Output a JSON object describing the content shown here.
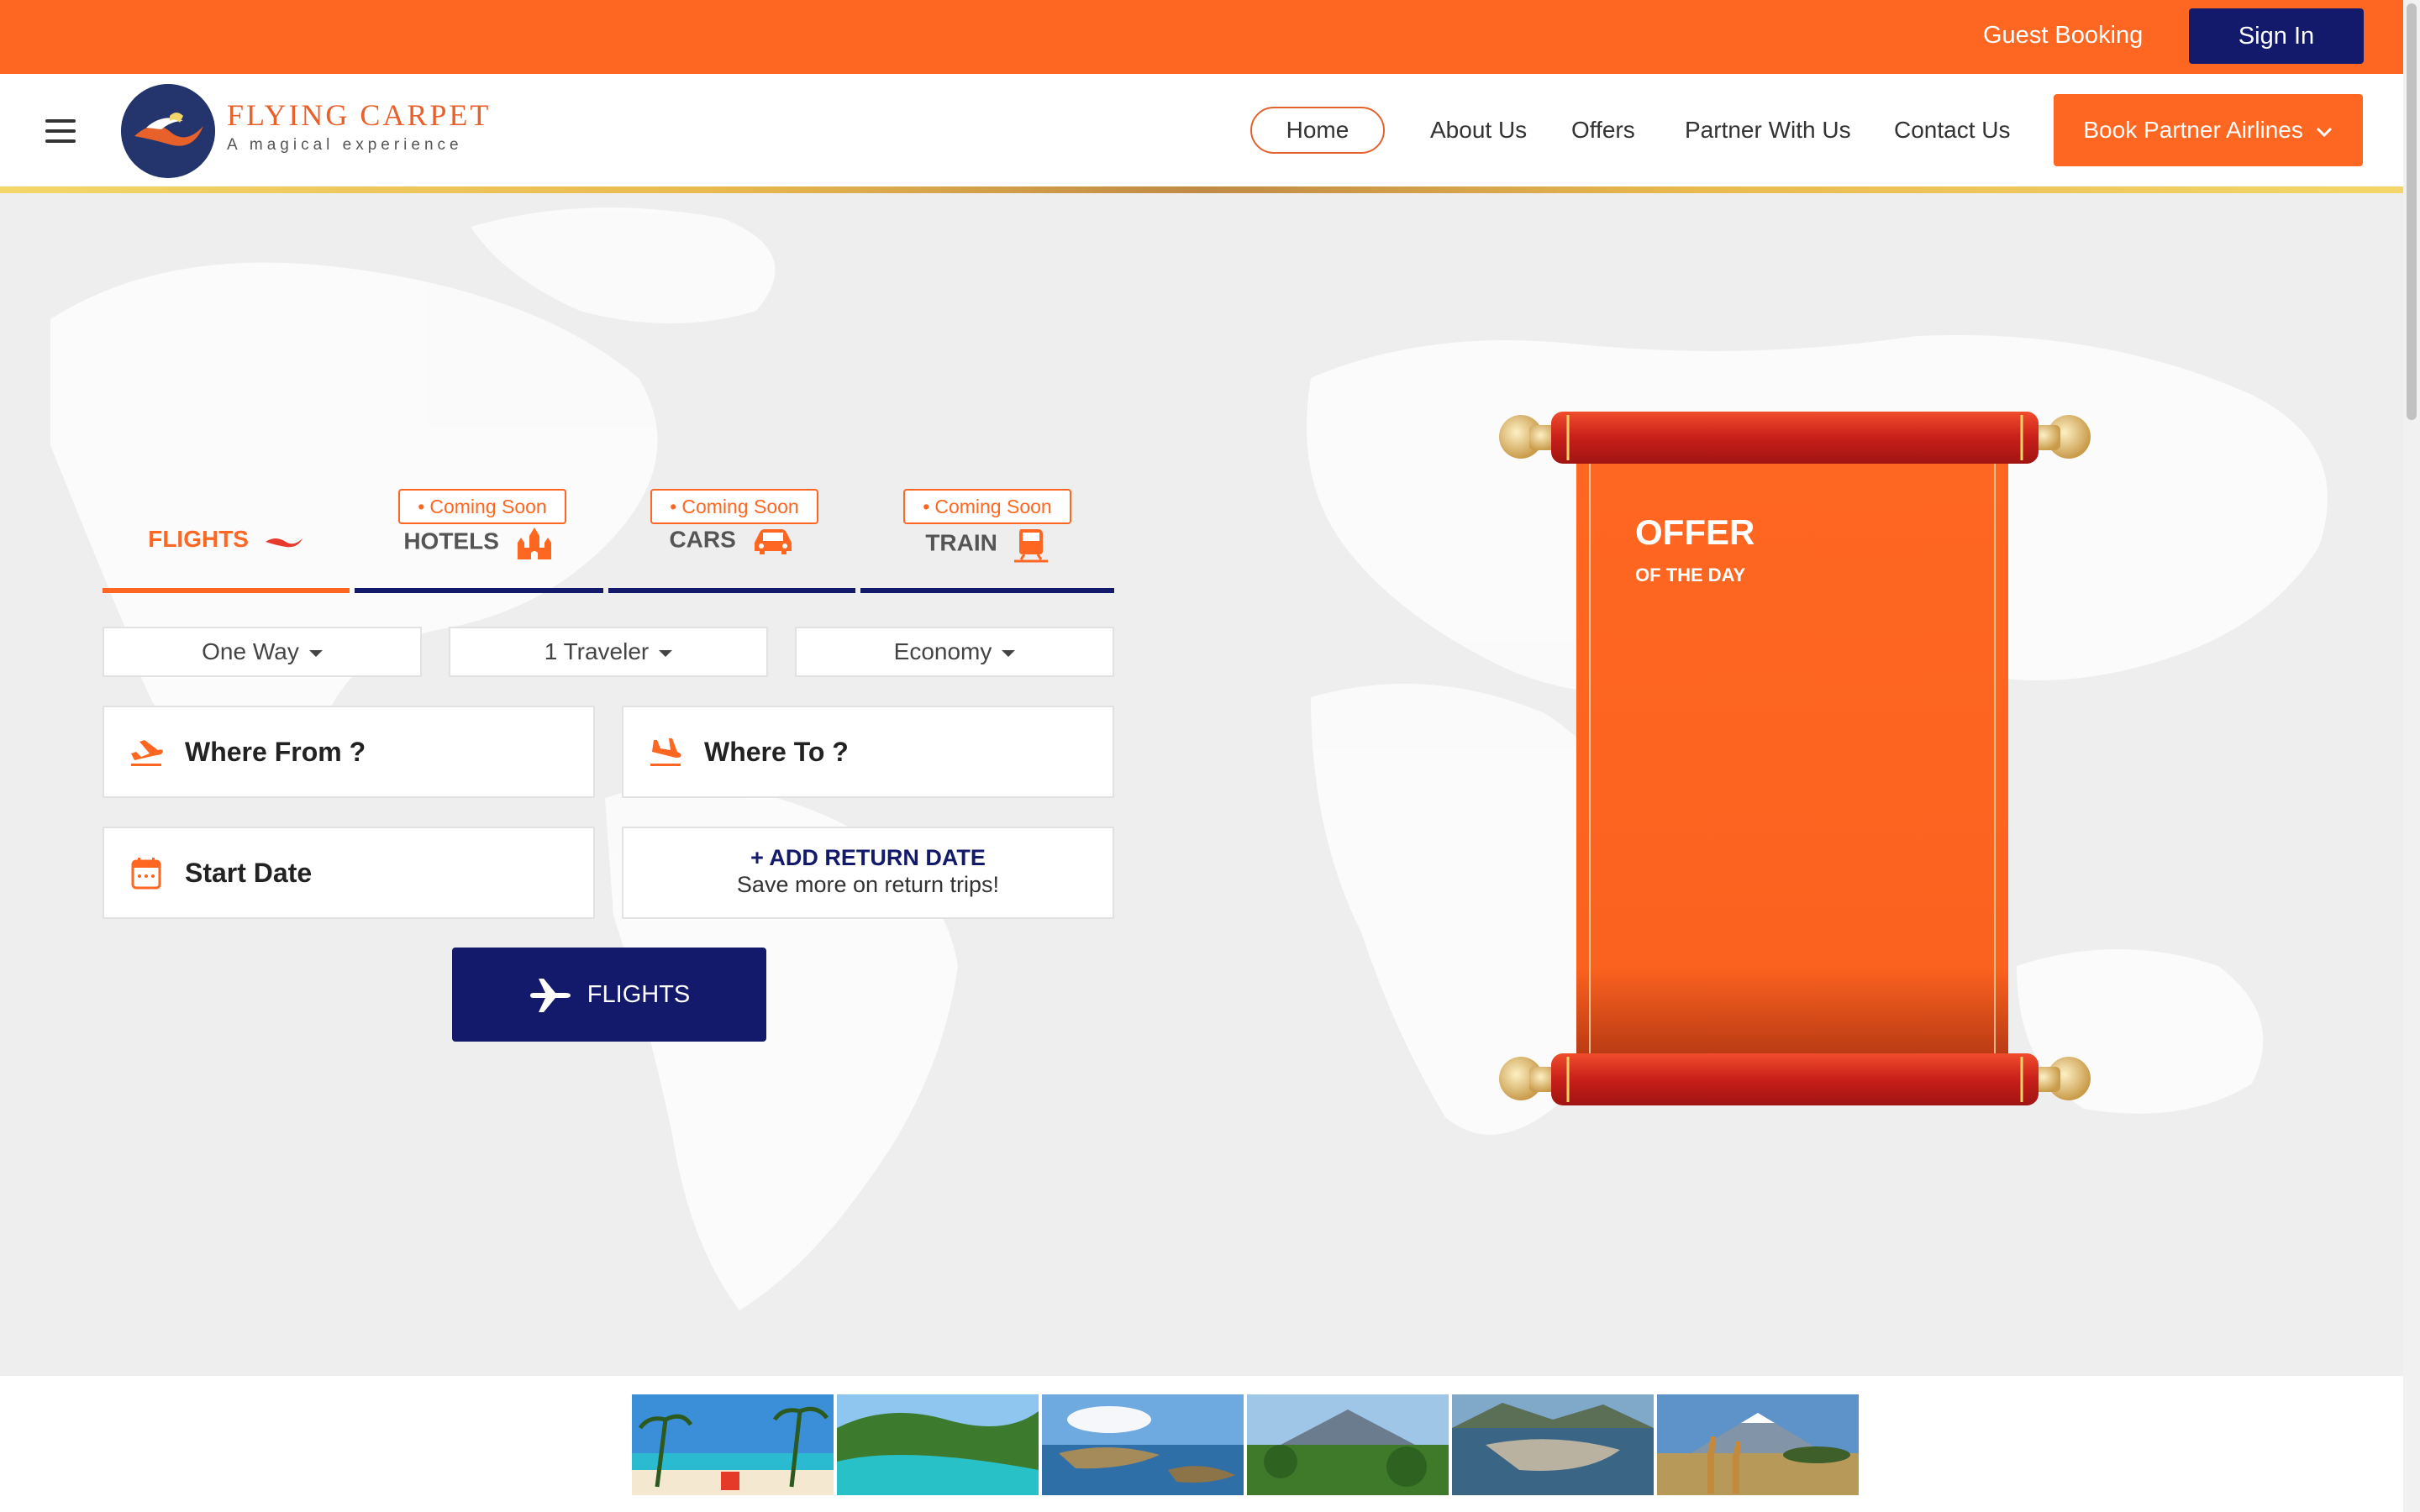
{
  "topbar": {
    "guest_booking": "Guest Booking",
    "sign_in": "Sign In"
  },
  "brand": {
    "name": "FLYING CARPET",
    "tagline": "A magical experience"
  },
  "nav": {
    "home": "Home",
    "about": "About Us",
    "offers": "Offers",
    "partner": "Partner With Us",
    "contact": "Contact Us",
    "book_partner": "Book Partner Airlines"
  },
  "tabs": [
    {
      "label": "FLIGHTS",
      "badge": ""
    },
    {
      "label": "HOTELS",
      "badge": "Coming Soon"
    },
    {
      "label": "CARS",
      "badge": "Coming Soon"
    },
    {
      "label": "TRAIN",
      "badge": "Coming Soon"
    }
  ],
  "search": {
    "trip_type": "One Way",
    "travelers": "1 Traveler",
    "cabin": "Economy",
    "from": "Where From ?",
    "to": "Where To ?",
    "start_date": "Start Date",
    "return_title": "+ ADD RETURN DATE",
    "return_sub": "Save more on return trips!",
    "submit": "FLIGHTS"
  },
  "offer": {
    "title": "OFFER",
    "subtitle": "OF THE DAY"
  },
  "colors": {
    "orange": "#fe6721",
    "navy": "#131a6b",
    "gold": "#e9b94f"
  },
  "thumbnails": [
    "beach-palms",
    "tropical-bay",
    "coastal-islands",
    "green-mountain",
    "coastal-city",
    "giraffes-kilimanjaro"
  ]
}
